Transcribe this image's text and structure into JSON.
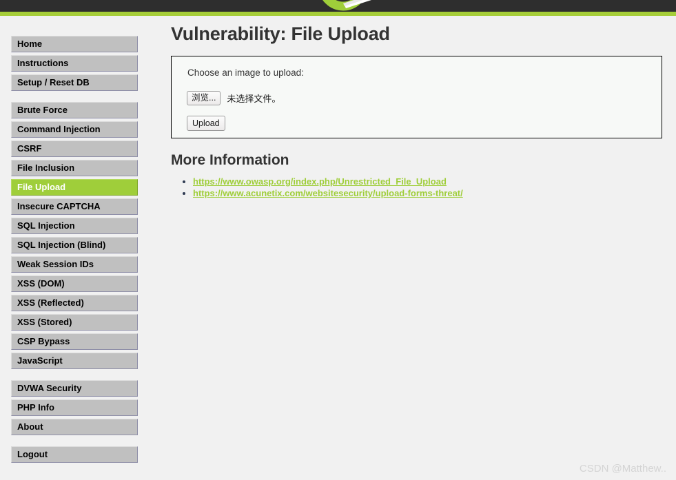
{
  "header": {
    "bar_color": "#2e2e2e",
    "stripe_color": "#a6ce39",
    "logo_icon": "dvwa-green-swoosh-logo"
  },
  "sidebar": {
    "groups": [
      {
        "items": [
          {
            "label": "Home",
            "selected": false
          },
          {
            "label": "Instructions",
            "selected": false
          },
          {
            "label": "Setup / Reset DB",
            "selected": false
          }
        ]
      },
      {
        "items": [
          {
            "label": "Brute Force",
            "selected": false
          },
          {
            "label": "Command Injection",
            "selected": false
          },
          {
            "label": "CSRF",
            "selected": false
          },
          {
            "label": "File Inclusion",
            "selected": false
          },
          {
            "label": "File Upload",
            "selected": true
          },
          {
            "label": "Insecure CAPTCHA",
            "selected": false
          },
          {
            "label": "SQL Injection",
            "selected": false
          },
          {
            "label": "SQL Injection (Blind)",
            "selected": false
          },
          {
            "label": "Weak Session IDs",
            "selected": false
          },
          {
            "label": "XSS (DOM)",
            "selected": false
          },
          {
            "label": "XSS (Reflected)",
            "selected": false
          },
          {
            "label": "XSS (Stored)",
            "selected": false
          },
          {
            "label": "CSP Bypass",
            "selected": false
          },
          {
            "label": "JavaScript",
            "selected": false
          }
        ]
      },
      {
        "items": [
          {
            "label": "DVWA Security",
            "selected": false
          },
          {
            "label": "PHP Info",
            "selected": false
          },
          {
            "label": "About",
            "selected": false
          }
        ]
      },
      {
        "items": [
          {
            "label": "Logout",
            "selected": false
          }
        ]
      }
    ],
    "selected_bg": "#9fce3a",
    "item_bg": "#c0c0c0"
  },
  "main": {
    "title": "Vulnerability: File Upload",
    "upload": {
      "prompt": "Choose an image to upload:",
      "browse_button_label": "浏览...",
      "file_status": "未选择文件。",
      "submit_label": "Upload"
    },
    "more_information": {
      "title": "More Information",
      "links": [
        "https://www.owasp.org/index.php/Unrestricted_File_Upload",
        "https://www.acunetix.com/websitesecurity/upload-forms-threat/"
      ],
      "link_color": "#9fce3a"
    }
  },
  "watermark": {
    "text": "CSDN @Matthew.."
  }
}
